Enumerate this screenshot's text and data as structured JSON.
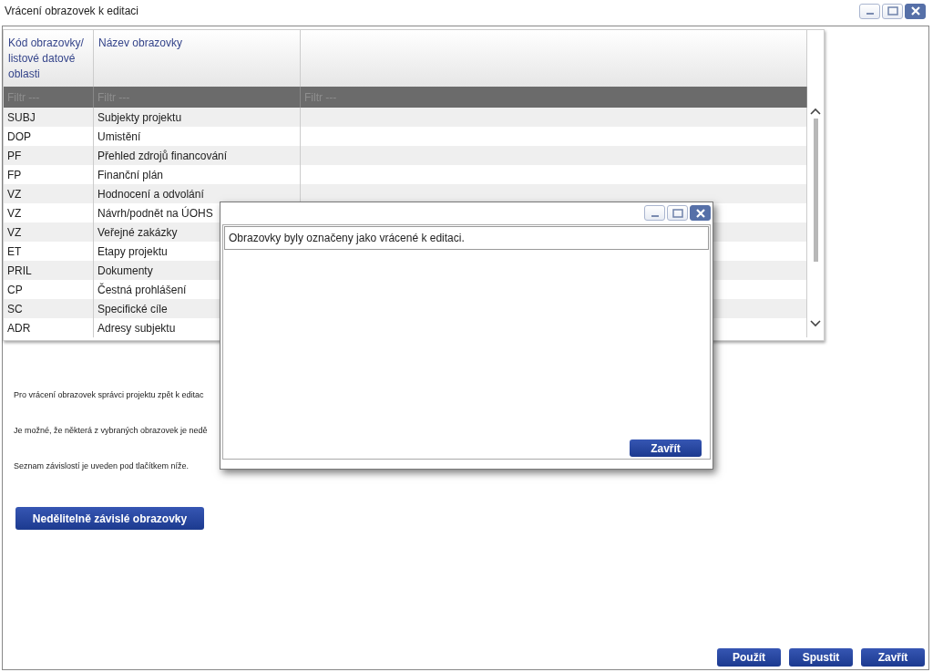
{
  "window": {
    "title": "Vrácení obrazovek k editaci"
  },
  "table": {
    "columns": [
      "Kód obrazovky/ listové datové oblasti",
      "Název obrazovky"
    ],
    "filters": [
      {
        "placeholder": "Filtr ---"
      },
      {
        "placeholder": "Filtr ---"
      },
      {
        "placeholder": "Filtr ---"
      }
    ],
    "rows": [
      [
        "SUBJ",
        "Subjekty projektu"
      ],
      [
        "DOP",
        "Umistění"
      ],
      [
        "PF",
        "Přehled zdrojů financování"
      ],
      [
        "FP",
        "Finanční plán"
      ],
      [
        "VZ",
        "Hodnocení a odvolání"
      ],
      [
        "VZ",
        "Návrh/podnět na ÚOHS"
      ],
      [
        "VZ",
        "Veřejné zakázky"
      ],
      [
        "ET",
        "Etapy projektu"
      ],
      [
        "PRIL",
        "Dokumenty"
      ],
      [
        "CP",
        "Čestná prohlášení"
      ],
      [
        "SC",
        "Specifické cíle"
      ],
      [
        "ADR",
        "Adresy subjektu"
      ]
    ]
  },
  "notes": [
    "Pro vrácení obrazovek správci projektu zpět k editac",
    "Je možné, že některá z vybraných obrazovek je nedě",
    "Seznam závislostí je uveden pod tlačítkem níže."
  ],
  "dependent_button": "Nedělitelně závislé obrazovky",
  "footer_buttons": [
    "Použít",
    "Spustit",
    "Zavřít"
  ],
  "dialog": {
    "message": "Obrazovky byly označeny jako vrácené k editaci.",
    "button": "Zavřít"
  }
}
